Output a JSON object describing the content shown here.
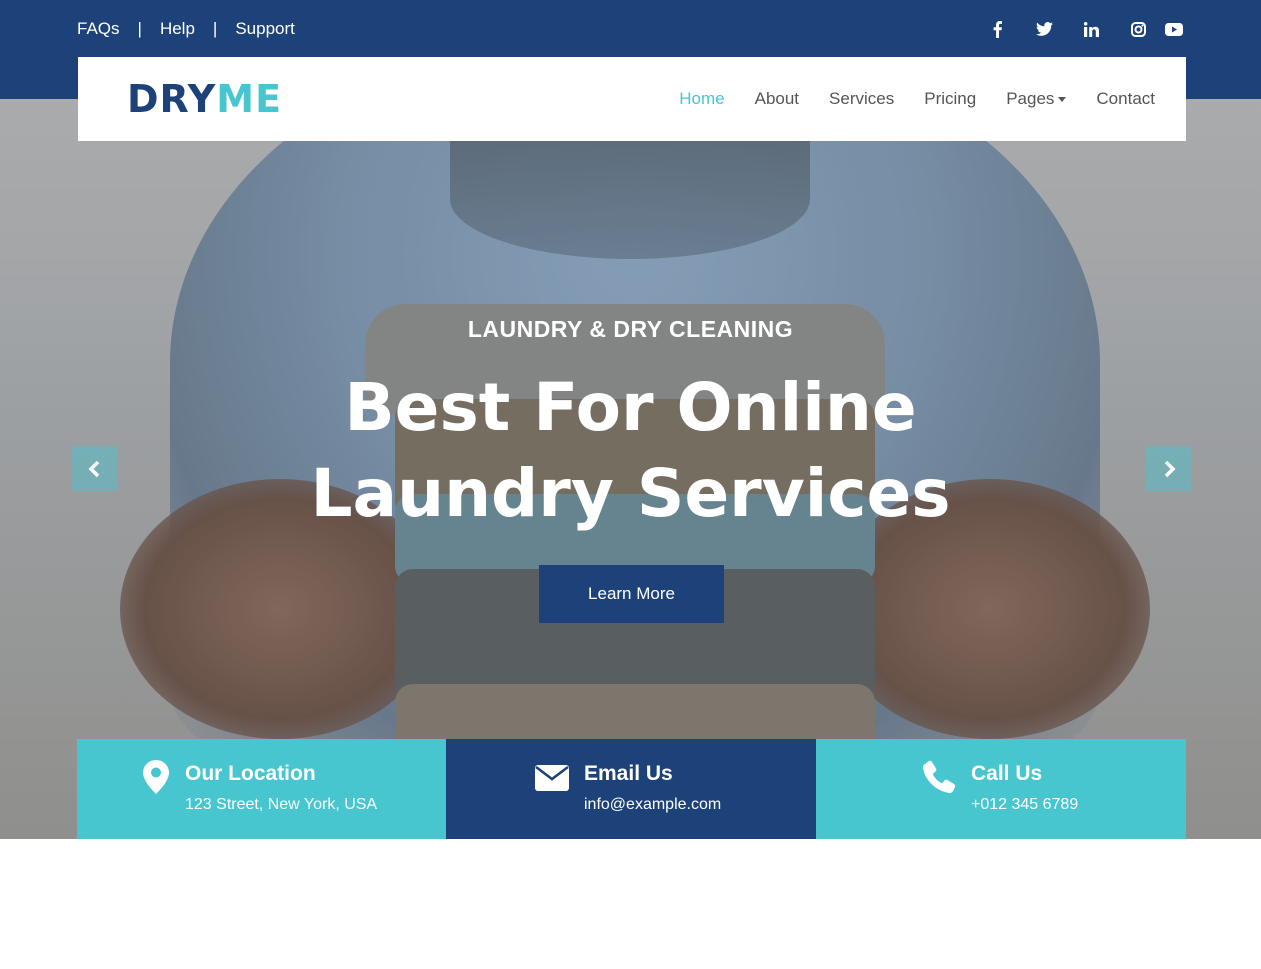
{
  "topbar": {
    "links": [
      "FAQs",
      "Help",
      "Support"
    ],
    "separator": "|",
    "social_icons": [
      "facebook-icon",
      "twitter-icon",
      "linkedin-icon",
      "instagram-icon",
      "youtube-icon"
    ],
    "social_glyphs": [
      "f",
      "t",
      "in",
      "◎",
      "▶"
    ]
  },
  "brand": {
    "part1": "DRY",
    "part2": "ME"
  },
  "nav": {
    "items": [
      "Home",
      "About",
      "Services",
      "Pricing",
      "Pages",
      "Contact"
    ],
    "active": "Home"
  },
  "hero": {
    "subtitle": "LAUNDRY & DRY CLEANING",
    "title_line1": "Best For Online",
    "title_line2": "Laundry Services",
    "button": "Learn More"
  },
  "contact": {
    "location": {
      "label": "Our Location",
      "value": "123 Street, New York, USA"
    },
    "email": {
      "label": "Email Us",
      "value": "info@example.com"
    },
    "phone": {
      "label": "Call Us",
      "value": "+012 345 6789"
    }
  },
  "colors": {
    "primary": "#1d4279",
    "accent": "#47c6d0",
    "white": "#ffffff"
  }
}
